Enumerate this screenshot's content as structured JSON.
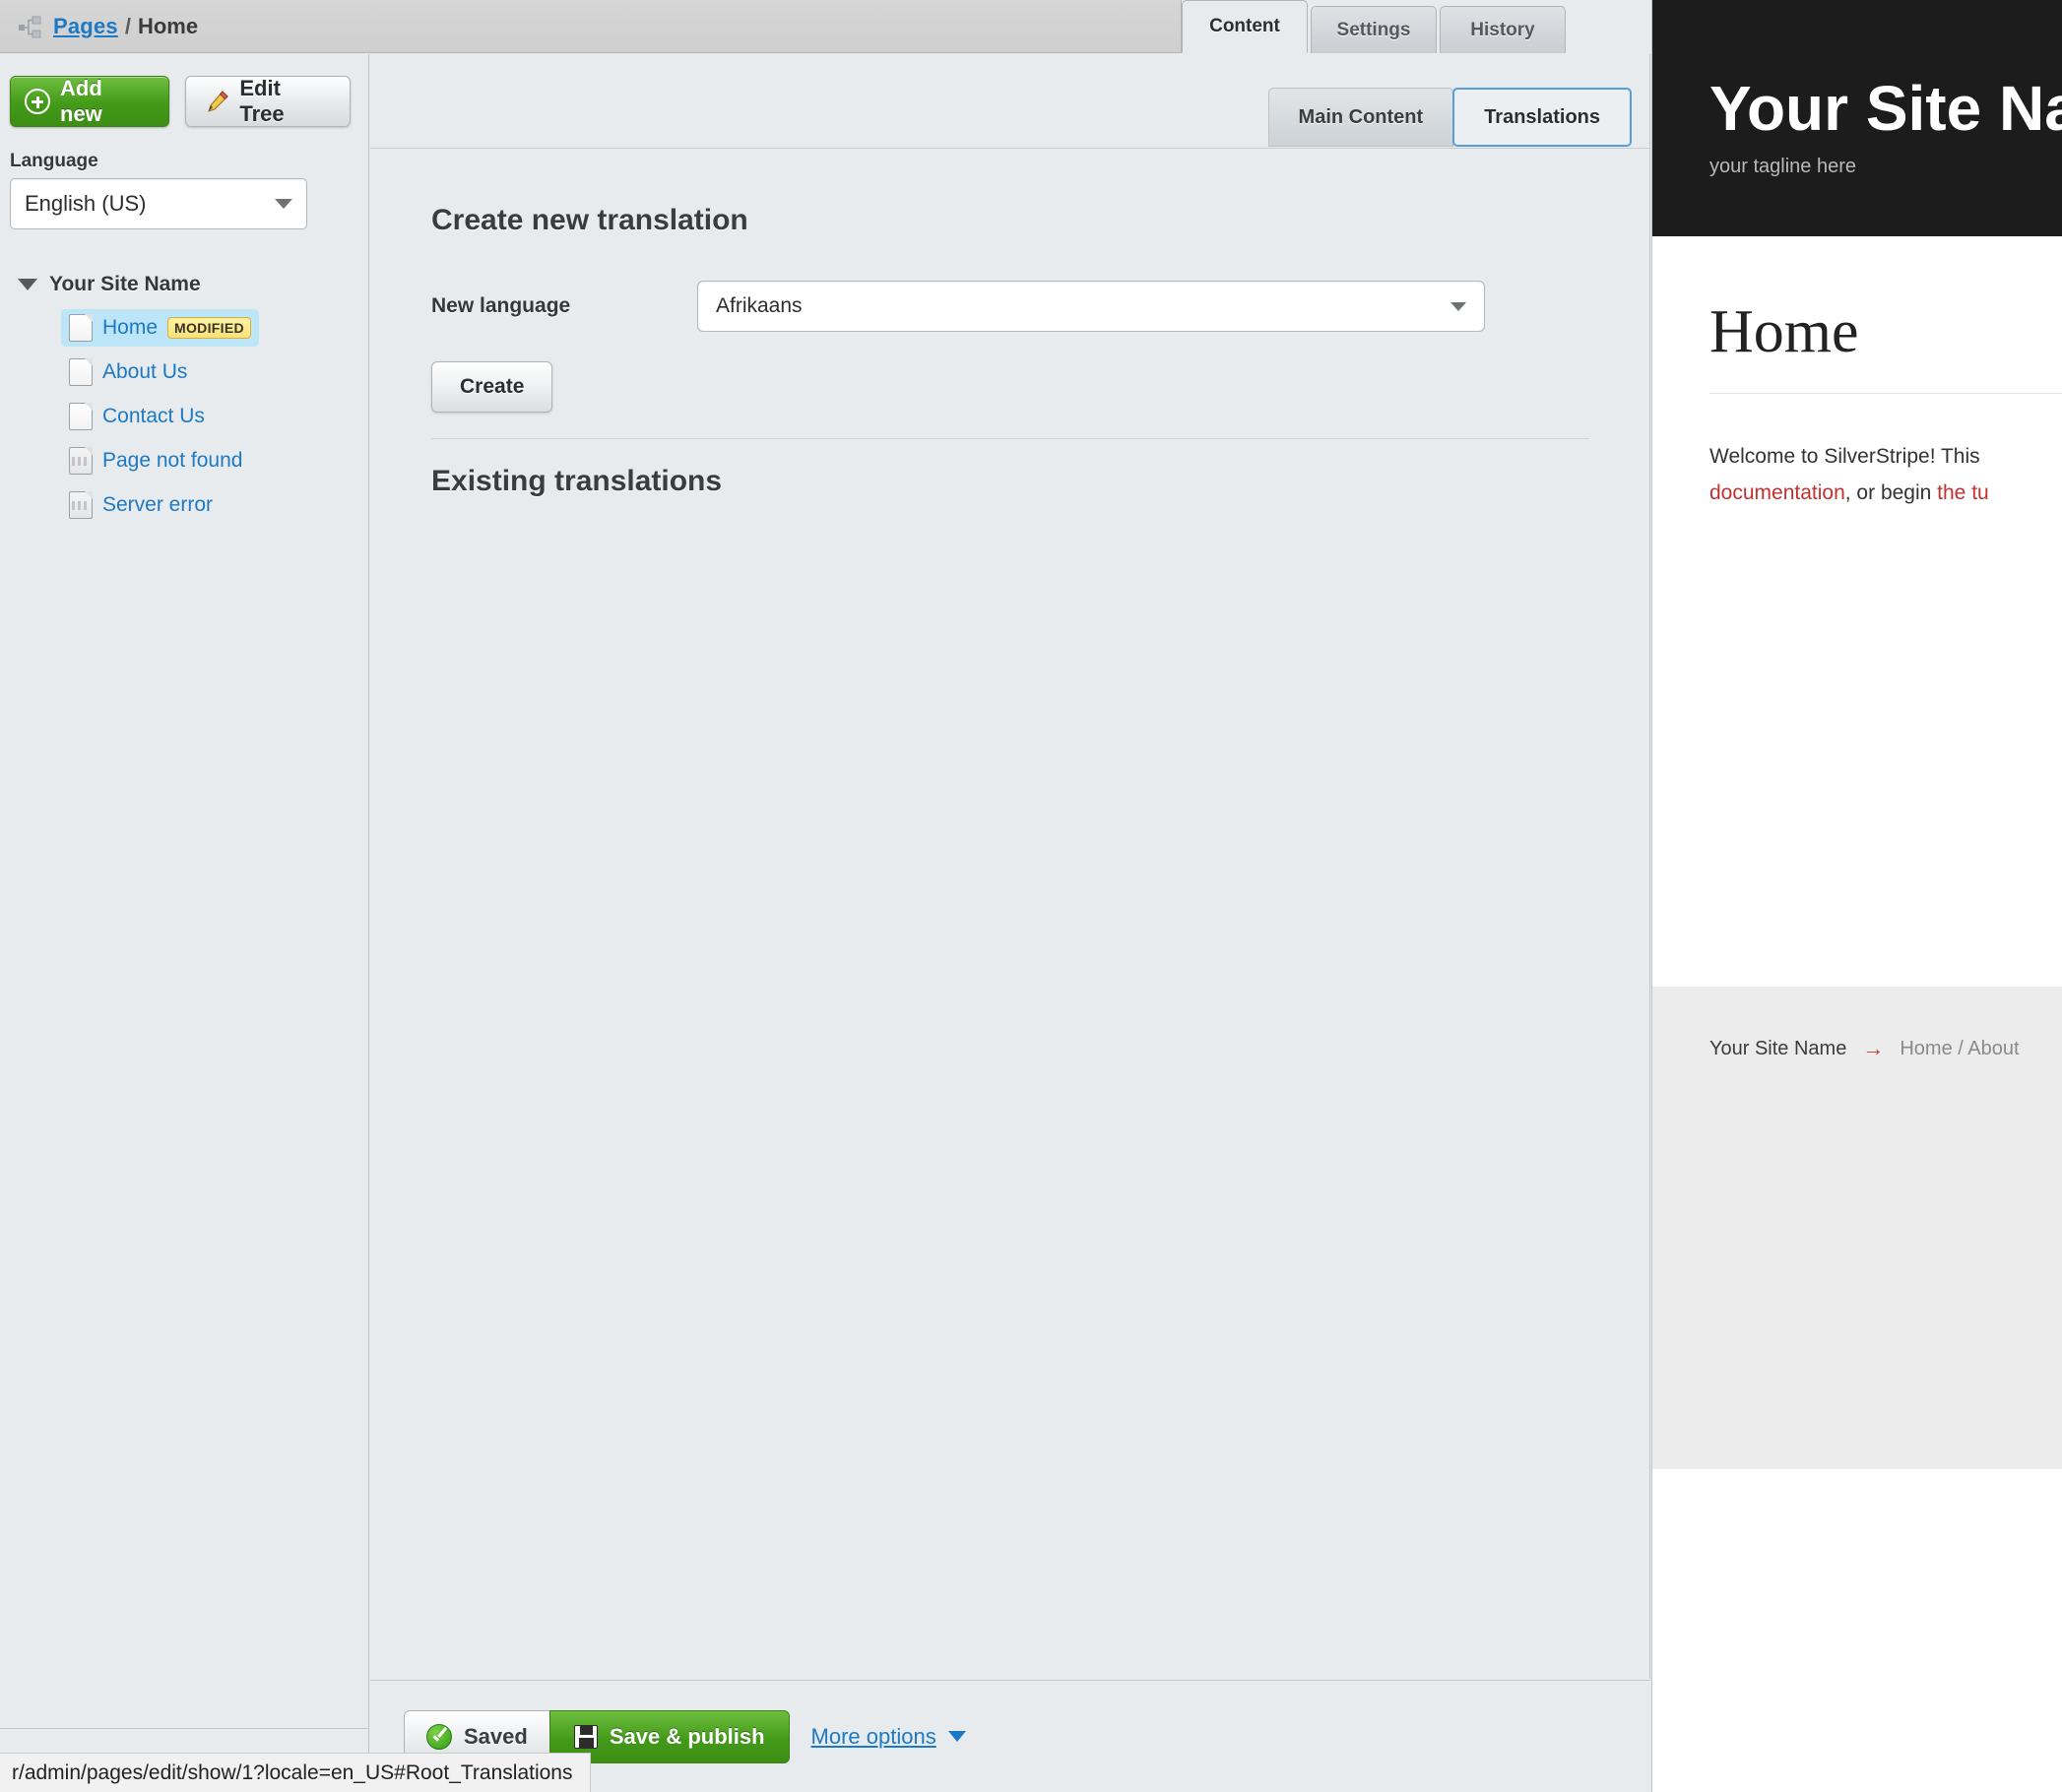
{
  "breadcrumb": {
    "icon": "sitetree-icon",
    "root": "Pages",
    "separator": "/",
    "current": "Home"
  },
  "main_tabs": [
    {
      "label": "Content",
      "active": true
    },
    {
      "label": "Settings",
      "active": false
    },
    {
      "label": "History",
      "active": false
    }
  ],
  "sidebar": {
    "add_new_label": "Add new",
    "edit_tree_label": "Edit Tree",
    "language_label": "Language",
    "language_value": "English (US)",
    "tree_root": "Your Site Name",
    "tree_items": [
      {
        "label": "Home",
        "badge": "MODIFIED",
        "selected": true,
        "icon": "page-icon"
      },
      {
        "label": "About Us",
        "badge": "",
        "selected": false,
        "icon": "page-icon"
      },
      {
        "label": "Contact Us",
        "badge": "",
        "selected": false,
        "icon": "page-icon"
      },
      {
        "label": "Page not found",
        "badge": "",
        "selected": false,
        "icon": "page-error-icon"
      },
      {
        "label": "Server error",
        "badge": "",
        "selected": false,
        "icon": "page-error-icon"
      }
    ]
  },
  "content": {
    "sub_tabs": [
      {
        "label": "Main Content",
        "active": false
      },
      {
        "label": "Translations",
        "active": true
      }
    ],
    "create_heading": "Create new translation",
    "new_language_label": "New language",
    "new_language_value": "Afrikaans",
    "create_button": "Create",
    "existing_heading": "Existing translations"
  },
  "preview": {
    "site_title": "Your Site Name",
    "tagline": "your tagline here",
    "page_heading": "Home",
    "body_text_1": "Welcome to SilverStripe! This ",
    "body_link_1": "documentation",
    "body_text_2": ", or begin ",
    "body_link_2": "the tu",
    "footer_site_name": "Your Site Name",
    "footer_arrow": "→",
    "footer_nav": "Home / About"
  },
  "bottom_bar": {
    "saved_label": "Saved",
    "save_publish_label": "Save & publish",
    "more_options_label": "More options"
  },
  "status_bar": {
    "url": "r/admin/pages/edit/show/1?locale=en_US#Root_Translations"
  },
  "colors": {
    "accent_blue": "#1d79c4",
    "green": "#439a19",
    "badge_yellow": "#f7e27a",
    "link_red": "#c3312f",
    "selected_row": "#bde5f8"
  }
}
